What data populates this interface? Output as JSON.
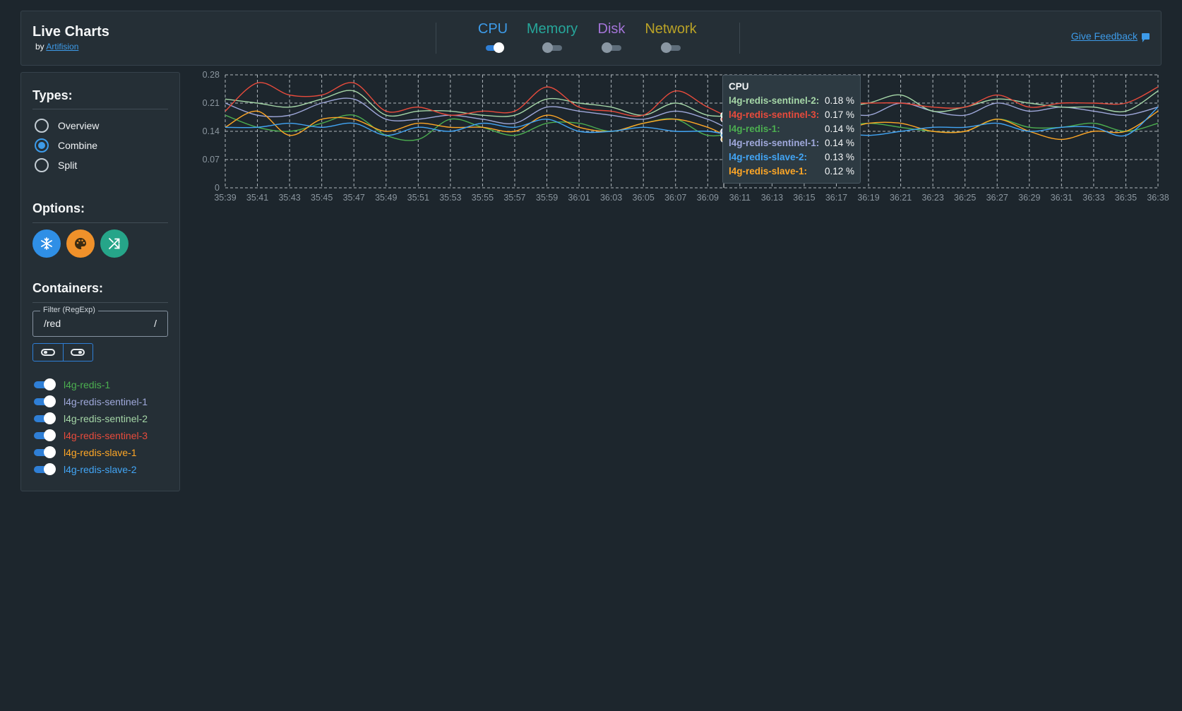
{
  "header": {
    "title": "Live Charts",
    "by_prefix": "by",
    "by_link": "Artifision",
    "metrics": [
      {
        "label": "CPU",
        "color": "#3d9be9",
        "on": true
      },
      {
        "label": "Memory",
        "color": "#26a69a",
        "on": false
      },
      {
        "label": "Disk",
        "color": "#a374d7",
        "on": false
      },
      {
        "label": "Network",
        "color": "#b9a227",
        "on": false
      }
    ],
    "feedback": "Give Feedback",
    "feedback_icon": "feedback-icon"
  },
  "sidebar": {
    "types_title": "Types:",
    "types": [
      {
        "label": "Overview",
        "selected": false
      },
      {
        "label": "Combine",
        "selected": true
      },
      {
        "label": "Split",
        "selected": false
      }
    ],
    "options_title": "Options:",
    "options": [
      {
        "icon": "snowflake-icon",
        "color": "#2f8fe6"
      },
      {
        "icon": "palette-icon",
        "color": "#f0912a"
      },
      {
        "icon": "shuffle-icon",
        "color": "#26a589"
      }
    ],
    "containers_title": "Containers:",
    "filter_label": "Filter (RegExp)",
    "filter_value": "/red",
    "filter_suffix": "/",
    "containers": [
      {
        "name": "l4g-redis-1",
        "color": "#4caf50",
        "on": true
      },
      {
        "name": "l4g-redis-sentinel-1",
        "color": "#9fa8da",
        "on": true
      },
      {
        "name": "l4g-redis-sentinel-2",
        "color": "#a5d6a7",
        "on": true
      },
      {
        "name": "l4g-redis-sentinel-3",
        "color": "#e84b3c",
        "on": true
      },
      {
        "name": "l4g-redis-slave-1",
        "color": "#ffa726",
        "on": true
      },
      {
        "name": "l4g-redis-slave-2",
        "color": "#42a5f5",
        "on": true
      }
    ]
  },
  "tooltip": {
    "title": "CPU",
    "rows": [
      {
        "name": "l4g-redis-sentinel-2:",
        "value": "0.18 %",
        "color": "#a5d6a7"
      },
      {
        "name": "l4g-redis-sentinel-3:",
        "value": "0.17 %",
        "color": "#e84b3c"
      },
      {
        "name": "l4g-redis-1:",
        "value": "0.14 %",
        "color": "#4caf50"
      },
      {
        "name": "l4g-redis-sentinel-1:",
        "value": "0.14 %",
        "color": "#9fa8da"
      },
      {
        "name": "l4g-redis-slave-2:",
        "value": "0.13 %",
        "color": "#42a5f5"
      },
      {
        "name": "l4g-redis-slave-1:",
        "value": "0.12 %",
        "color": "#ffa726"
      }
    ]
  },
  "chart_data": {
    "type": "line",
    "ylim": [
      0,
      0.28
    ],
    "yticks": [
      "0.28",
      "0.21",
      "0.14",
      "0.07",
      "0"
    ],
    "x": [
      "35:39",
      "35:41",
      "35:43",
      "35:45",
      "35:47",
      "35:49",
      "35:51",
      "35:53",
      "35:55",
      "35:57",
      "35:59",
      "36:01",
      "36:03",
      "36:05",
      "36:07",
      "36:09",
      "36:11",
      "36:13",
      "36:15",
      "36:17",
      "36:19",
      "36:21",
      "36:23",
      "36:25",
      "36:27",
      "36:29",
      "36:31",
      "36:33",
      "36:35",
      "36:38"
    ],
    "grid": true,
    "series": [
      {
        "name": "l4g-redis-1",
        "color": "#4caf50",
        "values": [
          0.18,
          0.15,
          0.14,
          0.16,
          0.18,
          0.13,
          0.12,
          0.17,
          0.15,
          0.13,
          0.16,
          0.16,
          0.14,
          0.16,
          0.17,
          0.13,
          0.14,
          0.15,
          0.15,
          0.15,
          0.16,
          0.15,
          0.14,
          0.14,
          0.17,
          0.15,
          0.15,
          0.16,
          0.14,
          0.16
        ]
      },
      {
        "name": "l4g-redis-sentinel-1",
        "color": "#9fa8da",
        "values": [
          0.21,
          0.18,
          0.18,
          0.21,
          0.22,
          0.17,
          0.17,
          0.18,
          0.17,
          0.16,
          0.2,
          0.19,
          0.18,
          0.17,
          0.19,
          0.17,
          0.14,
          0.17,
          0.19,
          0.19,
          0.18,
          0.21,
          0.19,
          0.18,
          0.21,
          0.19,
          0.2,
          0.19,
          0.18,
          0.2
        ]
      },
      {
        "name": "l4g-redis-sentinel-2",
        "color": "#a5d6a7",
        "values": [
          0.22,
          0.21,
          0.2,
          0.22,
          0.24,
          0.18,
          0.19,
          0.19,
          0.18,
          0.18,
          0.22,
          0.21,
          0.2,
          0.18,
          0.21,
          0.18,
          0.18,
          0.19,
          0.2,
          0.2,
          0.21,
          0.23,
          0.19,
          0.2,
          0.22,
          0.21,
          0.2,
          0.2,
          0.19,
          0.24
        ]
      },
      {
        "name": "l4g-redis-sentinel-3",
        "color": "#e84b3c",
        "values": [
          0.19,
          0.26,
          0.23,
          0.23,
          0.26,
          0.19,
          0.2,
          0.18,
          0.19,
          0.19,
          0.25,
          0.2,
          0.19,
          0.18,
          0.24,
          0.2,
          0.17,
          0.2,
          0.21,
          0.21,
          0.21,
          0.21,
          0.2,
          0.2,
          0.23,
          0.2,
          0.21,
          0.21,
          0.21,
          0.25
        ]
      },
      {
        "name": "l4g-redis-slave-1",
        "color": "#ffa726",
        "values": [
          0.15,
          0.19,
          0.13,
          0.17,
          0.17,
          0.14,
          0.16,
          0.15,
          0.15,
          0.14,
          0.18,
          0.15,
          0.14,
          0.16,
          0.17,
          0.15,
          0.12,
          0.15,
          0.15,
          0.14,
          0.16,
          0.16,
          0.14,
          0.14,
          0.17,
          0.14,
          0.12,
          0.14,
          0.14,
          0.19
        ]
      },
      {
        "name": "l4g-redis-slave-2",
        "color": "#42a5f5",
        "values": [
          0.15,
          0.15,
          0.16,
          0.15,
          0.16,
          0.13,
          0.15,
          0.14,
          0.16,
          0.15,
          0.17,
          0.14,
          0.14,
          0.15,
          0.14,
          0.14,
          0.13,
          0.15,
          0.16,
          0.14,
          0.13,
          0.14,
          0.15,
          0.15,
          0.16,
          0.14,
          0.15,
          0.15,
          0.13,
          0.2
        ]
      }
    ],
    "hover_x": "36:10"
  }
}
